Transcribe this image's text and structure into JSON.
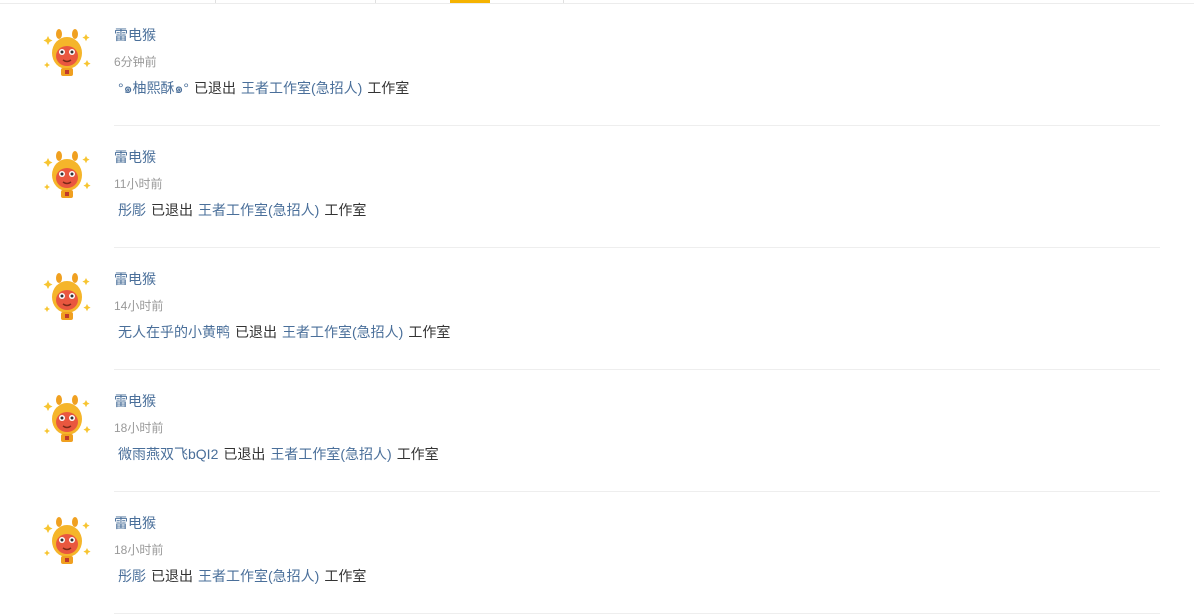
{
  "colors": {
    "link": "#4a6f9a",
    "text": "#333333",
    "muted": "#999999",
    "accent_tab": "#f5b301"
  },
  "feed": [
    {
      "user": "雷电猴",
      "time": "6分钟前",
      "actor": "°๑柚熙酥๑°",
      "verb": "已退出",
      "studio": "王者工作室(急招人)",
      "suffix": "工作室",
      "avatar_icon": "monkey-avatar-icon"
    },
    {
      "user": "雷电猴",
      "time": "11小时前",
      "actor": "彤彫",
      "verb": "已退出",
      "studio": "王者工作室(急招人)",
      "suffix": "工作室",
      "avatar_icon": "monkey-avatar-icon"
    },
    {
      "user": "雷电猴",
      "time": "14小时前",
      "actor": "无人在乎的小黄鸭",
      "verb": "已退出",
      "studio": "王者工作室(急招人)",
      "suffix": "工作室",
      "avatar_icon": "monkey-avatar-icon"
    },
    {
      "user": "雷电猴",
      "time": "18小时前",
      "actor": "微雨燕双飞bQI2",
      "verb": "已退出",
      "studio": "王者工作室(急招人)",
      "suffix": "工作室",
      "avatar_icon": "monkey-avatar-icon"
    },
    {
      "user": "雷电猴",
      "time": "18小时前",
      "actor": "彤彫",
      "verb": "已退出",
      "studio": "王者工作室(急招人)",
      "suffix": "工作室",
      "avatar_icon": "monkey-avatar-icon"
    }
  ]
}
